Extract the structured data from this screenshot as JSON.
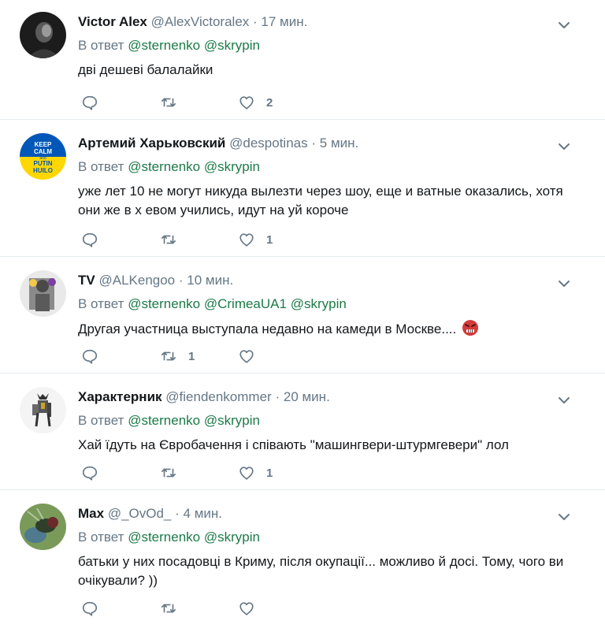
{
  "reply_prefix": "В ответ",
  "tweets": [
    {
      "name": "Victor Alex",
      "handle": "@AlexVictoralex",
      "dot": "·",
      "time": "17 мин.",
      "mentions": [
        "@sternenko",
        "@skrypin"
      ],
      "text": "дві дешеві балалайки",
      "replies": "",
      "retweets": "",
      "likes": "2",
      "avatar_icon": "dark-silhouette-avatar"
    },
    {
      "name": "Артемий Харьковский",
      "handle": "@despotinas",
      "dot": "·",
      "time": "5 мин.",
      "mentions": [
        "@sternenko",
        "@skrypin"
      ],
      "text": "уже лет 10 не могут никуда вылезти через шоу, еще и ватные оказались, хотя они же в х евом учились, идут на уй короче",
      "replies": "",
      "retweets": "",
      "likes": "1",
      "avatar_text": [
        "KEEP",
        "CALM",
        "and",
        "PUTIN",
        "HUILO"
      ],
      "avatar_colors": {
        "top": "#0057b7",
        "bottom": "#ffd700"
      }
    },
    {
      "name": "TV",
      "handle": "@ALKengoo",
      "dot": "·",
      "time": "10 мин.",
      "mentions": [
        "@sternenko",
        "@CrimeaUA1",
        "@skrypin"
      ],
      "text": "Другая участница выступала недавно на камеди в Москве....",
      "text_emoji": "angry-face-emoji",
      "replies": "",
      "retweets": "1",
      "likes": "",
      "avatar_icon": "grey-figure-avatar"
    },
    {
      "name": "Характерник",
      "handle": "@fiendenkommer",
      "dot": "·",
      "time": "20 мин.",
      "mentions": [
        "@sternenko",
        "@skrypin"
      ],
      "text": "Хай їдуть на Євробачення і співають \"машингвери-штурмгевери\" лол",
      "replies": "",
      "retweets": "",
      "likes": "1",
      "avatar_icon": "warrior-figure-avatar"
    },
    {
      "name": "Max",
      "handle": "@_OvOd_",
      "dot": "·",
      "time": "4 мин.",
      "mentions": [
        "@sternenko",
        "@skrypin"
      ],
      "text": "батьки у них посадовці в Криму, після окупації... можливо й досі. Тому, чого ви очікували? ))",
      "replies": "",
      "retweets": "",
      "likes": "",
      "avatar_icon": "fly-closeup-avatar"
    }
  ],
  "colors": {
    "mention": "#1b7a47",
    "secondary_text": "#657786",
    "divider": "#e6ecf0"
  }
}
